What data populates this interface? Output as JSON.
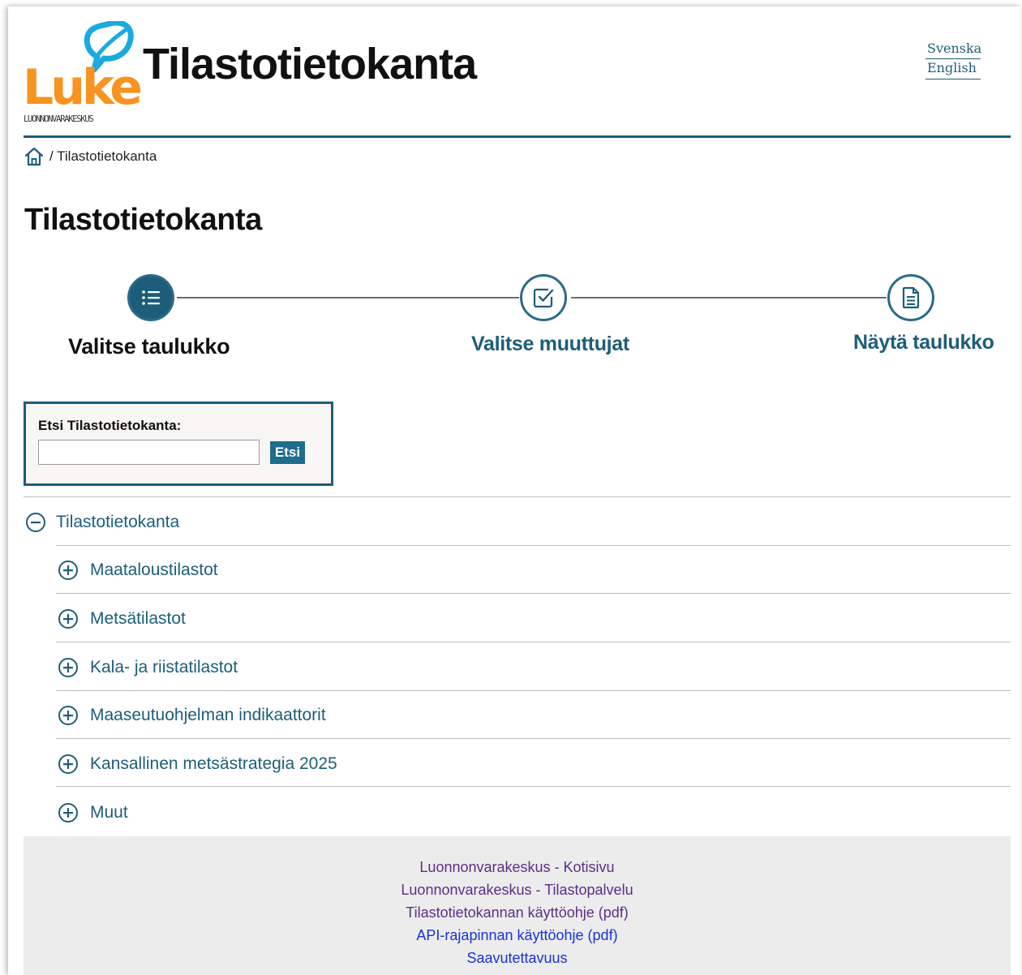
{
  "header": {
    "logo_word": "Luke",
    "logo_subtitle": "LUONNONVARAKESKUS",
    "site_title": "Tilastotietokanta",
    "languages": [
      "Svenska",
      "English"
    ]
  },
  "breadcrumb": {
    "current": "/ Tilastotietokanta"
  },
  "page_title": "Tilastotietokanta",
  "steps": [
    {
      "label": "Valitse taulukko",
      "state": "active",
      "icon": "list-icon"
    },
    {
      "label": "Valitse muuttujat",
      "state": "link",
      "icon": "checkbox-icon"
    },
    {
      "label": "Näytä taulukko",
      "state": "link",
      "icon": "document-icon"
    }
  ],
  "search": {
    "label": "Etsi Tilastotietokanta:",
    "value": "",
    "button": "Etsi"
  },
  "tree": {
    "root": {
      "label": "Tilastotietokanta",
      "icon": "collapse-minus-icon"
    },
    "children": [
      {
        "label": "Maataloustilastot",
        "icon": "expand-plus-icon"
      },
      {
        "label": "Metsätilastot",
        "icon": "expand-plus-icon"
      },
      {
        "label": "Kala- ja riistatilastot",
        "icon": "expand-plus-icon"
      },
      {
        "label": "Maaseutuohjelman indikaattorit",
        "icon": "expand-plus-icon"
      },
      {
        "label": "Kansallinen metsästrategia 2025",
        "icon": "expand-plus-icon"
      },
      {
        "label": "Muut",
        "icon": "expand-plus-icon"
      }
    ]
  },
  "footer": {
    "links": [
      "Luonnonvarakeskus - Kotisivu",
      "Luonnonvarakeskus - Tilastopalvelu",
      "Tilastotietokannan käyttöohje (pdf)",
      "API-rajapinnan käyttöohje (pdf)",
      "Saavutettavuus"
    ]
  },
  "colors": {
    "brand_teal": "#1d5d79",
    "logo_orange": "#f7931e",
    "logo_cyan": "#1aa9e0",
    "visited_link": "#5b2e8a",
    "link": "#1a33d6"
  }
}
